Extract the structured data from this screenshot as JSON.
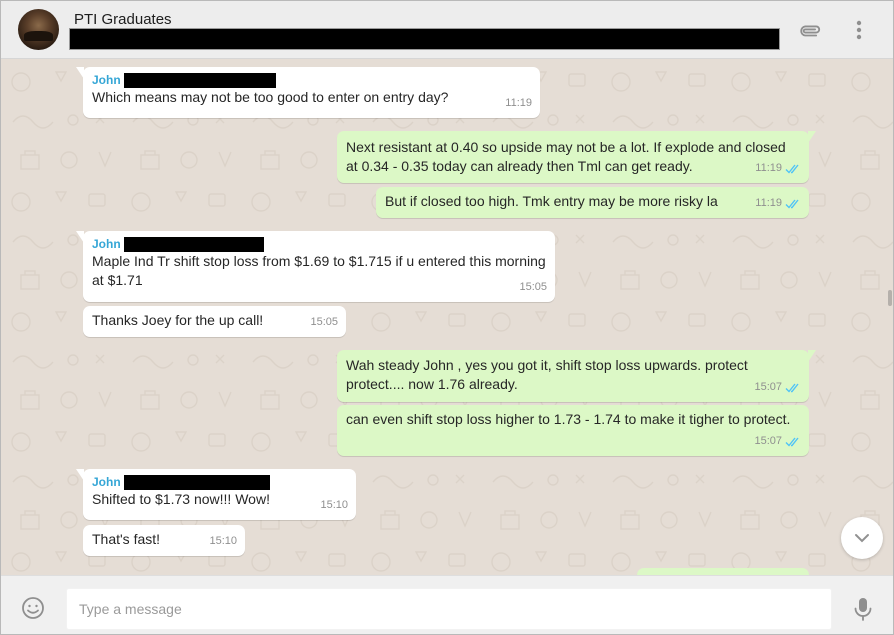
{
  "header": {
    "chat_title": "PTI Graduates",
    "attach_icon": "paperclip-icon",
    "menu_icon": "more-vert-icon"
  },
  "messages": [
    {
      "direction": "in",
      "sender": "John",
      "text": "Which means may not be too good to enter on entry day?",
      "time": "11:19"
    },
    {
      "direction": "out",
      "text": "Next resistant at 0.40 so upside may not be a lot. If explode and closed at 0.34 - 0.35 today can already then Tml can get ready.",
      "time": "11:19",
      "status": "read"
    },
    {
      "direction": "out",
      "text": "But if closed too high. Tmk entry may be more risky la",
      "time": "11:19",
      "status": "read"
    },
    {
      "direction": "in",
      "sender": "John",
      "text": "Maple Ind Tr shift stop loss from $1.69 to $1.715 if u entered this morning at $1.71",
      "time": "15:05"
    },
    {
      "direction": "in",
      "text": "Thanks Joey for the up call!",
      "time": "15:05"
    },
    {
      "direction": "out",
      "text": "Wah steady John , yes you got it, shift stop loss upwards. protect protect.... now 1.76 already.",
      "time": "15:07",
      "status": "read"
    },
    {
      "direction": "out",
      "text": "can even shift stop loss higher to 1.73 - 1.74 to make it tigher to protect.",
      "time": "15:07",
      "status": "read"
    },
    {
      "direction": "in",
      "sender": "John",
      "text": "Shifted to $1.73 now!!! Wow!",
      "time": "15:10"
    },
    {
      "direction": "in",
      "text": "That's fast!",
      "time": "15:10"
    }
  ],
  "composer": {
    "placeholder": "Type a message",
    "emoji_icon": "smiley-icon",
    "mic_icon": "microphone-icon"
  },
  "colors": {
    "chat_background": "#e5ddd5",
    "incoming_bubble": "#ffffff",
    "outgoing_bubble": "#dcf8c6",
    "sender_name": "#35a6d6",
    "read_ticks": "#4fc3f7"
  }
}
